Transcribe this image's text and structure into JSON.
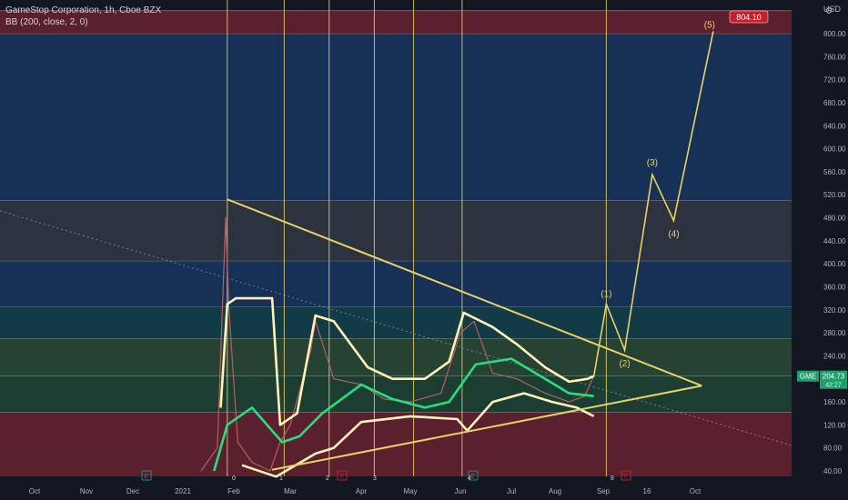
{
  "header": {
    "symbol_line": "GameStop Corporation, 1h, Cboe BZX",
    "indicator_line": "BB (200, close, 2, 0)",
    "currency": "USD"
  },
  "price_badge": {
    "symbol": "GME",
    "price": "204.73",
    "countdown": "42:27"
  },
  "target_badge": "804.10",
  "wave_labels": [
    "(1)",
    "(2)",
    "(3)",
    "(4)",
    "(5)"
  ],
  "event_markers": {
    "earnings": "E",
    "numbers": [
      "0",
      "1",
      "2",
      "3",
      "4",
      "8"
    ]
  },
  "colors": {
    "background": "#131722",
    "yellow": "#e8d268",
    "bb_outer": "#fff3b8",
    "bb_mid": "#26e07f",
    "price": "#b56060",
    "badge_red": "#c81e2a",
    "badge_green": "#1f9f6e"
  },
  "chart_data": {
    "type": "line",
    "title": "GameStop Corporation, 1h, Cboe BZX",
    "x_ticks": [
      "Oct",
      "Nov",
      "Dec",
      "2021",
      "Feb",
      "Mar",
      "Apr",
      "May",
      "Jun",
      "Jul",
      "Aug",
      "Sep",
      "16",
      "Oct"
    ],
    "y_ticks": [
      40,
      80,
      120,
      160,
      200,
      240,
      280,
      320,
      360,
      400,
      440,
      480,
      520,
      560,
      600,
      640,
      680,
      720,
      760,
      800
    ],
    "y_range": [
      30,
      840
    ],
    "price_zones": [
      {
        "from": 30,
        "to": 142,
        "color": "red"
      },
      {
        "from": 142,
        "to": 205,
        "color": "green"
      },
      {
        "from": 205,
        "to": 270,
        "color": "lightgreen"
      },
      {
        "from": 270,
        "to": 325,
        "color": "teal"
      },
      {
        "from": 325,
        "to": 405,
        "color": "blue"
      },
      {
        "from": 405,
        "to": 510,
        "color": "gray"
      },
      {
        "from": 510,
        "to": 800,
        "color": "blue"
      },
      {
        "from": 800,
        "to": 840,
        "color": "red"
      }
    ],
    "series": [
      {
        "name": "BB upper",
        "points": [
          [
            "Jan 24",
            150
          ],
          [
            "Jan 28",
            330
          ],
          [
            "Feb 2",
            340
          ],
          [
            "Feb 20",
            340
          ],
          [
            "Feb 24",
            120
          ],
          [
            "Mar 4",
            140
          ],
          [
            "Mar 12",
            310
          ],
          [
            "Mar 20",
            300
          ],
          [
            "Apr 5",
            220
          ],
          [
            "Apr 20",
            200
          ],
          [
            "May 10",
            200
          ],
          [
            "May 25",
            230
          ],
          [
            "Jun 3",
            315
          ],
          [
            "Jun 20",
            290
          ],
          [
            "Jul 5",
            260
          ],
          [
            "Jul 25",
            220
          ],
          [
            "Aug 10",
            195
          ],
          [
            "Aug 22",
            200
          ],
          [
            "Aug 26",
            205
          ]
        ]
      },
      {
        "name": "BB basis",
        "points": [
          [
            "Jan 20",
            40
          ],
          [
            "Jan 28",
            120
          ],
          [
            "Feb 10",
            150
          ],
          [
            "Feb 25",
            90
          ],
          [
            "Mar 5",
            100
          ],
          [
            "Mar 15",
            140
          ],
          [
            "Apr 1",
            190
          ],
          [
            "Apr 20",
            165
          ],
          [
            "May 10",
            150
          ],
          [
            "May 25",
            160
          ],
          [
            "Jun 10",
            225
          ],
          [
            "Jul 1",
            235
          ],
          [
            "Jul 25",
            200
          ],
          [
            "Aug 10",
            175
          ],
          [
            "Aug 26",
            170
          ]
        ]
      },
      {
        "name": "BB lower",
        "points": [
          [
            "Feb 5",
            50
          ],
          [
            "Feb 22",
            30
          ],
          [
            "Mar 12",
            70
          ],
          [
            "Mar 20",
            80
          ],
          [
            "Apr 1",
            125
          ],
          [
            "May 1",
            135
          ],
          [
            "May 30",
            130
          ],
          [
            "Jun 5",
            110
          ],
          [
            "Jun 20",
            160
          ],
          [
            "Jul 10",
            175
          ],
          [
            "Jul 30",
            160
          ],
          [
            "Aug 15",
            150
          ],
          [
            "Aug 26",
            135
          ]
        ]
      },
      {
        "name": "Price",
        "points": [
          [
            "Jan 12",
            40
          ],
          [
            "Jan 22",
            80
          ],
          [
            "Jan 27",
            480
          ],
          [
            "Jan 29",
            320
          ],
          [
            "Feb 3",
            90
          ],
          [
            "Feb 10",
            55
          ],
          [
            "Feb 19",
            40
          ],
          [
            "Feb 24",
            90
          ],
          [
            "Mar 1",
            120
          ],
          [
            "Mar 10",
            250
          ],
          [
            "Mar 12",
            300
          ],
          [
            "Mar 20",
            200
          ],
          [
            "Apr 1",
            190
          ],
          [
            "Apr 15",
            165
          ],
          [
            "May 1",
            160
          ],
          [
            "May 20",
            175
          ],
          [
            "Jun 1",
            280
          ],
          [
            "Jun 9",
            300
          ],
          [
            "Jun 20",
            210
          ],
          [
            "Jul 5",
            200
          ],
          [
            "Jul 25",
            175
          ],
          [
            "Aug 10",
            160
          ],
          [
            "Aug 20",
            170
          ],
          [
            "Aug 26",
            205
          ]
        ]
      }
    ],
    "triangle": {
      "upper": [
        [
          "Jan 28",
          512
        ],
        [
          "Oct 5",
          188
        ]
      ],
      "lower": [
        [
          "Feb 20",
          42
        ],
        [
          "Oct 5",
          188
        ]
      ]
    },
    "wave_projection": [
      {
        "label": "",
        "date": "Aug 26",
        "value": 205
      },
      {
        "label": "(1)",
        "date": "Sep 2",
        "value": 330
      },
      {
        "label": "(2)",
        "date": "Sep 8",
        "value": 250
      },
      {
        "label": "(3)",
        "date": "Sep 17",
        "value": 555
      },
      {
        "label": "(4)",
        "date": "Sep 24",
        "value": 475
      },
      {
        "label": "(5)",
        "date": "Oct 12",
        "value": 804.1
      }
    ],
    "current_price": 204.73,
    "target_price": 804.1
  }
}
